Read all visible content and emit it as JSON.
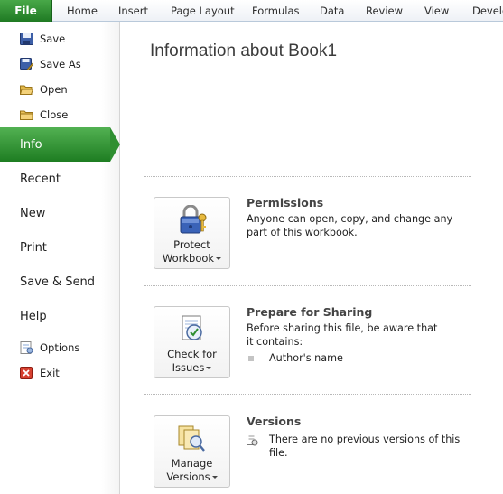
{
  "ribbon": {
    "file_tab": "File",
    "tabs": [
      "Home",
      "Insert",
      "Page Layout",
      "Formulas",
      "Data",
      "Review",
      "View",
      "Develo"
    ]
  },
  "nav": {
    "commands_top": [
      {
        "label": "Save",
        "icon": "save-icon"
      },
      {
        "label": "Save As",
        "icon": "save-as-icon"
      },
      {
        "label": "Open",
        "icon": "open-folder-icon"
      },
      {
        "label": "Close",
        "icon": "close-folder-icon"
      }
    ],
    "tabs": [
      "Info",
      "Recent",
      "New",
      "Print",
      "Save & Send",
      "Help"
    ],
    "active_tab": "Info",
    "commands_bottom": [
      {
        "label": "Options",
        "icon": "options-icon"
      },
      {
        "label": "Exit",
        "icon": "exit-icon"
      }
    ]
  },
  "main": {
    "title": "Information about Book1",
    "permissions": {
      "button": [
        "Protect",
        "Workbook"
      ],
      "title": "Permissions",
      "desc": "Anyone can open, copy, and change any part of this workbook."
    },
    "sharing": {
      "button": [
        "Check for",
        "Issues"
      ],
      "title": "Prepare for Sharing",
      "desc": "Before sharing this file, be aware that it contains:",
      "bullet": "Author's name"
    },
    "versions": {
      "button": [
        "Manage",
        "Versions"
      ],
      "title": "Versions",
      "desc": "There are no previous versions of this file."
    }
  },
  "colors": {
    "accent_green": "#2f8f31",
    "ribbon_border": "#b9c9da"
  }
}
